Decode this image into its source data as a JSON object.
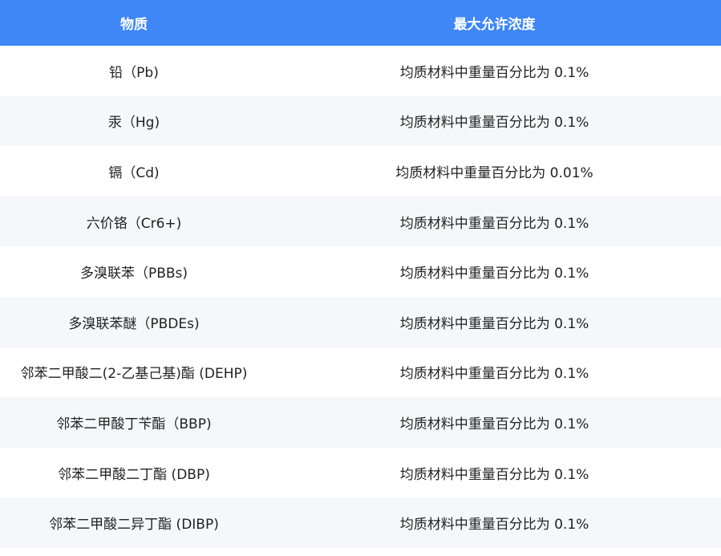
{
  "table": {
    "headers": [
      "物质",
      "最大允许浓度"
    ],
    "rows": [
      {
        "substance": "铅（Pb)",
        "limit": "均质材料中重量百分比为 0.1%"
      },
      {
        "substance": "汞（Hg)",
        "limit": "均质材料中重量百分比为 0.1%"
      },
      {
        "substance": "镉（Cd)",
        "limit": "均质材料中重量百分比为 0.01%"
      },
      {
        "substance": "六价铬（Cr6+)",
        "limit": "均质材料中重量百分比为 0.1%"
      },
      {
        "substance": "多溴联苯（PBBs)",
        "limit": "均质材料中重量百分比为 0.1%"
      },
      {
        "substance": "多溴联苯醚（PBDEs)",
        "limit": "均质材料中重量百分比为 0.1%"
      },
      {
        "substance": "邻苯二甲酸二(2-乙基己基)酯 (DEHP)",
        "limit": "均质材料中重量百分比为 0.1%"
      },
      {
        "substance": "邻苯二甲酸丁苄酯（BBP)",
        "limit": "均质材料中重量百分比为 0.1%"
      },
      {
        "substance": "邻苯二甲酸二丁酯 (DBP)",
        "limit": "均质材料中重量百分比为 0.1%"
      },
      {
        "substance": "邻苯二甲酸二异丁酯 (DIBP)",
        "limit": "均质材料中重量百分比为 0.1%"
      }
    ]
  },
  "colors": {
    "header_bg": "#3f86f7",
    "alt_row_bg": "#f5f7fb"
  }
}
